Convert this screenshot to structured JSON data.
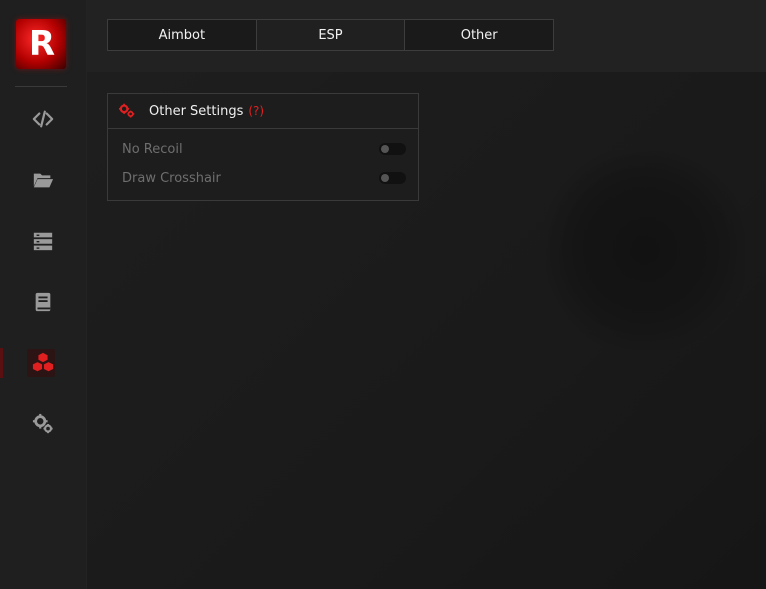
{
  "tabs": [
    {
      "label": "Aimbot"
    },
    {
      "label": "ESP"
    },
    {
      "label": "Other"
    }
  ],
  "panel": {
    "title": "Other Settings",
    "help": "(?)",
    "rows": [
      {
        "label": "No Recoil",
        "enabled": false
      },
      {
        "label": "Draw Crosshair",
        "enabled": false
      }
    ]
  },
  "logo": {
    "letter": "R"
  },
  "sidebar": {
    "icons": [
      "code-icon",
      "folder-open-icon",
      "list-icon",
      "book-icon",
      "cubes-icon",
      "gears-icon"
    ],
    "active": "cubes-icon"
  },
  "colors": {
    "accent": "#e02020",
    "background": "#1b1b1b",
    "border": "#3a3a3a"
  }
}
